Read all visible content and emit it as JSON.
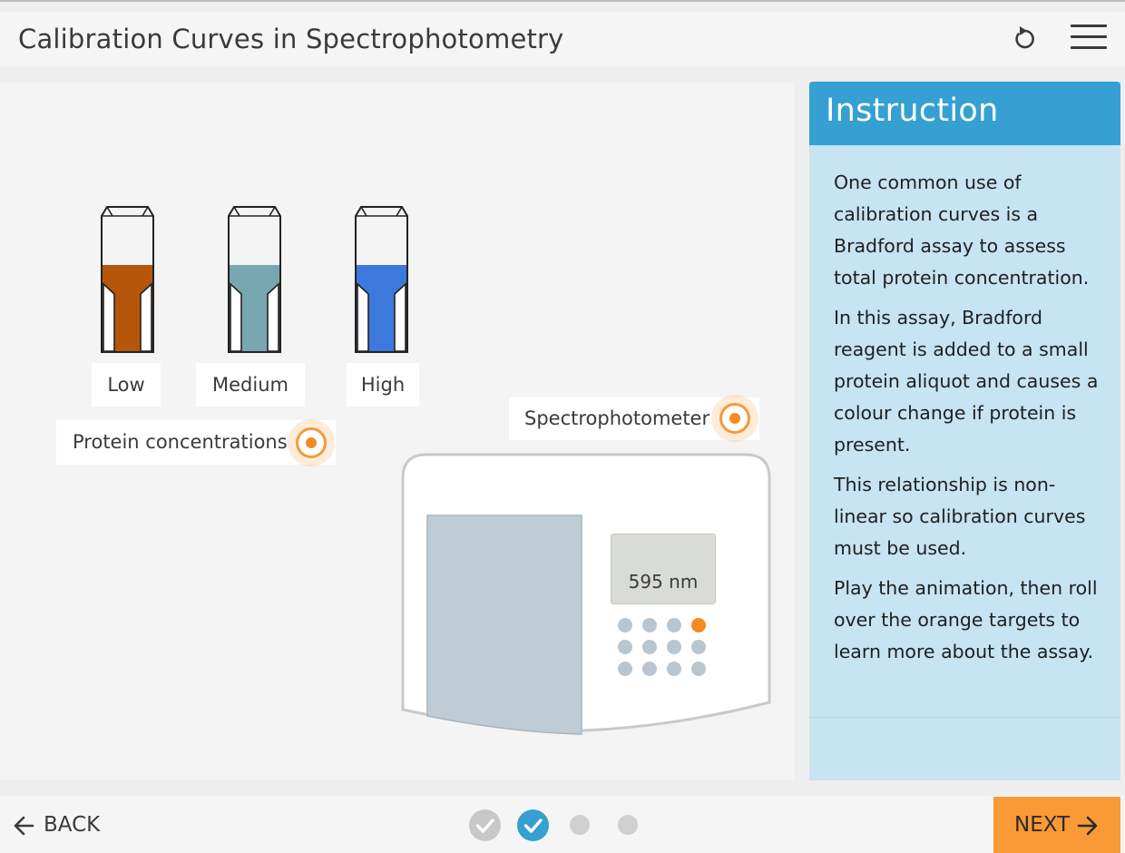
{
  "header": {
    "title": "Calibration Curves in Spectrophotometry"
  },
  "stage": {
    "cuvettes": [
      {
        "label": "Low",
        "color": "#b5560b"
      },
      {
        "label": "Medium",
        "color": "#78a7b1"
      },
      {
        "label": "High",
        "color": "#3d79dc"
      }
    ],
    "protein_target_label": "Protein concentrations",
    "spectro_target_label": "Spectrophotometer",
    "display_value": "595 nm",
    "target_color": "#f58a24"
  },
  "instruction": {
    "title": "Instruction",
    "paragraphs": [
      "One common use of calibration curves is a Bradford assay to assess total protein concentration.",
      "In this assay, Bradford reagent is added to a small protein aliquot and causes a colour change if protein is present.",
      "This relationship is non-linear so calibration curves must be used.",
      "Play the animation, then roll over the orange targets to learn more about the assay."
    ]
  },
  "footer": {
    "back_label": "BACK",
    "next_label": "NEXT",
    "progress": [
      {
        "state": "completed",
        "color": "#c8c8c8"
      },
      {
        "state": "current",
        "color": "#35a0d1"
      },
      {
        "state": "upcoming",
        "color": "#cfcfcf"
      },
      {
        "state": "upcoming",
        "color": "#cfcfcf"
      }
    ]
  }
}
